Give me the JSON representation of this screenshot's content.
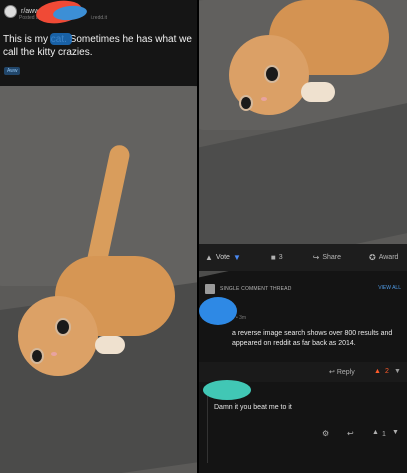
{
  "post": {
    "subreddit": "r/aww",
    "meta_prefix": "Posted by",
    "site": "i.redd.it",
    "title": "This is my cat. Sometimes he has what we call the kitty crazies.",
    "flair": "Aww"
  },
  "actions": {
    "vote_label": "Vote",
    "comment_count": "3",
    "share_label": "Share",
    "award_label": "Award"
  },
  "comments_section": {
    "single_thread_label": "SINGLE COMMENT THREAD",
    "view_all_label": "VIEW ALL",
    "comment1": {
      "meta": "• 3m",
      "text": "a reverse image search shows over 800 results and appeared on reddit as far back as 2014.",
      "reply_label": "Reply",
      "score": "2"
    },
    "comment2": {
      "text": "Damn it you beat me to it",
      "score": "1"
    }
  },
  "colors": {
    "accent_blue": "#4a8af4",
    "upvote_orange": "#ff5b2a",
    "background": "#141414"
  }
}
